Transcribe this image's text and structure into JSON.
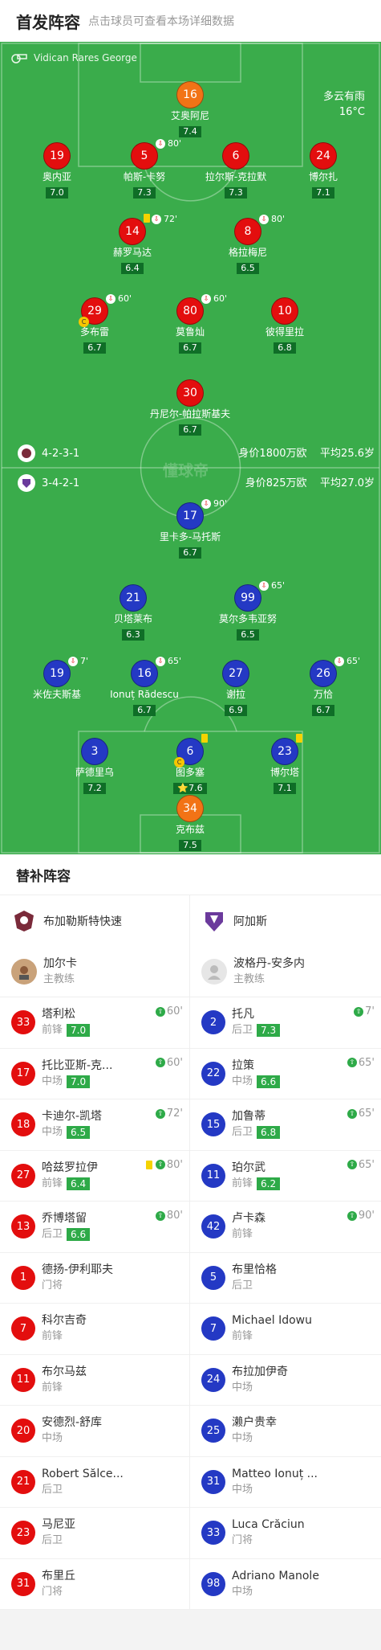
{
  "header": {
    "title": "首发阵容",
    "subtitle": "点击球员可查看本场详细数据"
  },
  "pitch": {
    "referee": "Vidican Rares George",
    "weather": "多云有雨",
    "temperature": "16°C",
    "watermark": "懂球帝",
    "home": {
      "formation": "4-2-3-1",
      "value": "身价1800万欧",
      "avg_age": "平均25.6岁"
    },
    "away": {
      "formation": "3-4-2-1",
      "value": "身价825万欧",
      "avg_age": "平均27.0岁"
    }
  },
  "home_players": [
    {
      "num": "16",
      "name": "艾奥阿尼",
      "rating": "7.4",
      "gk": true
    },
    {
      "num": "19",
      "name": "奥内亚",
      "rating": "7.0"
    },
    {
      "num": "5",
      "name": "帕斯-卡努",
      "rating": "7.3",
      "sub": "80'"
    },
    {
      "num": "6",
      "name": "拉尔斯-克拉默",
      "rating": "7.3"
    },
    {
      "num": "24",
      "name": "博尔扎",
      "rating": "7.1"
    },
    {
      "num": "14",
      "name": "赫罗马达",
      "rating": "6.4",
      "sub": "72'",
      "yellow": true
    },
    {
      "num": "8",
      "name": "格拉梅尼",
      "rating": "6.5",
      "sub": "80'"
    },
    {
      "num": "29",
      "name": "多布雷",
      "rating": "6.7",
      "sub": "60'",
      "captain": true
    },
    {
      "num": "80",
      "name": "莫鲁灿",
      "rating": "6.7",
      "sub": "60'"
    },
    {
      "num": "10",
      "name": "彼得里拉",
      "rating": "6.8"
    },
    {
      "num": "30",
      "name": "丹尼尔-帕拉斯基夫",
      "rating": "6.7"
    }
  ],
  "away_players": [
    {
      "num": "17",
      "name": "里卡多-马托斯",
      "rating": "6.7",
      "sub": "90'"
    },
    {
      "num": "21",
      "name": "贝塔莱布",
      "rating": "6.3"
    },
    {
      "num": "99",
      "name": "莫尔多韦亚努",
      "rating": "6.5",
      "sub": "65'"
    },
    {
      "num": "19",
      "name": "米佐夫斯基",
      "rating": "",
      "sub": "7'"
    },
    {
      "num": "16",
      "name": "Ionuț Rădescu",
      "rating": "6.7",
      "sub": "65'"
    },
    {
      "num": "27",
      "name": "谢拉",
      "rating": "6.9"
    },
    {
      "num": "26",
      "name": "万恰",
      "rating": "6.7",
      "sub": "65'"
    },
    {
      "num": "3",
      "name": "萨德里乌",
      "rating": "7.2"
    },
    {
      "num": "6",
      "name": "图多塞",
      "rating": "⭐7.6",
      "yellow": true,
      "captain": true
    },
    {
      "num": "23",
      "name": "博尔塔",
      "rating": "7.1",
      "yellow": true
    },
    {
      "num": "34",
      "name": "克布兹",
      "rating": "7.5",
      "gk": true
    }
  ],
  "bench": {
    "title": "替补阵容",
    "home": {
      "club": "布加勒斯特快速",
      "coach": "加尔卡",
      "coach_role": "主教练",
      "subs": [
        {
          "num": "33",
          "name": "塔利松",
          "pos": "前锋",
          "rating": "7.0",
          "sub": "60'"
        },
        {
          "num": "17",
          "name": "托比亚斯-克...",
          "pos": "中场",
          "rating": "7.0",
          "sub": "60'"
        },
        {
          "num": "18",
          "name": "卡迪尔-凯塔",
          "pos": "中场",
          "rating": "6.5",
          "sub": "72'"
        },
        {
          "num": "27",
          "name": "哈兹罗拉伊",
          "pos": "前锋",
          "rating": "6.4",
          "sub": "80'",
          "yellow": true
        },
        {
          "num": "13",
          "name": "乔博塔留",
          "pos": "后卫",
          "rating": "6.6",
          "sub": "80'"
        },
        {
          "num": "1",
          "name": "德扬-伊利耶夫",
          "pos": "门将"
        },
        {
          "num": "7",
          "name": "科尔吉奇",
          "pos": "前锋"
        },
        {
          "num": "11",
          "name": "布尔马兹",
          "pos": "前锋"
        },
        {
          "num": "20",
          "name": "安德烈-舒库",
          "pos": "中场"
        },
        {
          "num": "21",
          "name": "Robert Sălce...",
          "pos": "后卫"
        },
        {
          "num": "23",
          "name": "马尼亚",
          "pos": "后卫"
        },
        {
          "num": "31",
          "name": "布里丘",
          "pos": "门将"
        }
      ]
    },
    "away": {
      "club": "阿加斯",
      "coach": "波格丹-安多内",
      "coach_role": "主教练",
      "subs": [
        {
          "num": "2",
          "name": "托凡",
          "pos": "后卫",
          "rating": "7.3",
          "sub": "7'"
        },
        {
          "num": "22",
          "name": "拉策",
          "pos": "中场",
          "rating": "6.6",
          "sub": "65'"
        },
        {
          "num": "15",
          "name": "加鲁蒂",
          "pos": "后卫",
          "rating": "6.8",
          "sub": "65'"
        },
        {
          "num": "11",
          "name": "珀尔武",
          "pos": "前锋",
          "rating": "6.2",
          "sub": "65'"
        },
        {
          "num": "42",
          "name": "卢卡森",
          "pos": "前锋",
          "sub": "90'"
        },
        {
          "num": "5",
          "name": "布里恰格",
          "pos": "后卫"
        },
        {
          "num": "7",
          "name": "Michael Idowu",
          "pos": "前锋"
        },
        {
          "num": "24",
          "name": "布拉加伊奇",
          "pos": "中场"
        },
        {
          "num": "25",
          "name": "濑户贵幸",
          "pos": "中场"
        },
        {
          "num": "31",
          "name": "Matteo Ionuț ...",
          "pos": "中场"
        },
        {
          "num": "33",
          "name": "Luca Crăciun",
          "pos": "门将"
        },
        {
          "num": "98",
          "name": "Adriano Manole",
          "pos": "中场"
        }
      ]
    }
  },
  "colors": {
    "home": "#e30e0e",
    "away": "#2439c4",
    "gk": "#f27316",
    "pitch": "#3aac4b"
  }
}
